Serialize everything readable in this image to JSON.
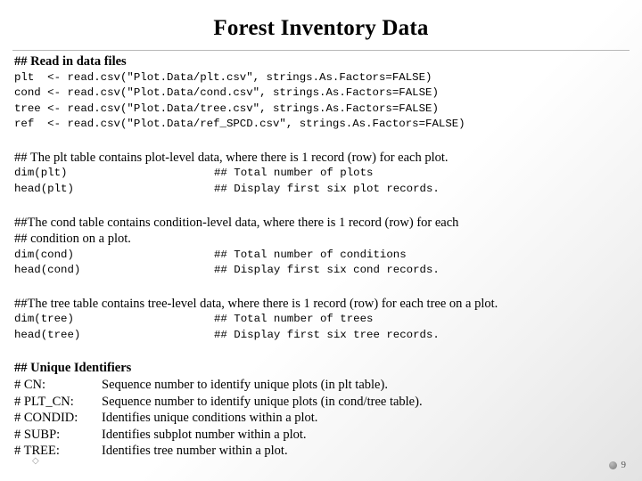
{
  "slide": {
    "title": "Forest Inventory Data",
    "page_number": "9",
    "sections": [
      {
        "heading": "## Read in data files",
        "code": [
          "plt  <- read.csv(\"Plot.Data/plt.csv\", strings.As.Factors=FALSE)",
          "cond <- read.csv(\"Plot.Data/cond.csv\", strings.As.Factors=FALSE)",
          "tree <- read.csv(\"Plot.Data/tree.csv\", strings.As.Factors=FALSE)",
          "ref  <- read.csv(\"Plot.Data/ref_SPCD.csv\", strings.As.Factors=FALSE)"
        ]
      },
      {
        "heading": "## The plt table contains plot-level data, where there is 1 record (row) for each plot.",
        "rows": [
          {
            "cmd": "dim(plt)",
            "comment": "## Total number of plots"
          },
          {
            "cmd": "head(plt)",
            "comment": "## Display first six plot records."
          }
        ]
      },
      {
        "heading": "##The cond table contains condition-level data, where there is 1 record (row) for each",
        "heading2": "## condition on a plot.",
        "rows": [
          {
            "cmd": "dim(cond)",
            "comment": "## Total number of conditions"
          },
          {
            "cmd": "head(cond)",
            "comment": "## Display first six cond records."
          }
        ]
      },
      {
        "heading": "##The tree table contains tree-level data, where there is 1 record (row) for each tree on a plot.",
        "rows": [
          {
            "cmd": "dim(tree)",
            "comment": "## Total number of trees"
          },
          {
            "cmd": "head(tree)",
            "comment": "## Display first six tree records."
          }
        ]
      }
    ],
    "identifiers": {
      "heading": "## Unique Identifiers",
      "items": [
        {
          "name": "# CN:",
          "desc": "Sequence number to identify unique plots (in plt table)."
        },
        {
          "name": "# PLT_CN:",
          "desc": "Sequence number to identify unique plots (in cond/tree table)."
        },
        {
          "name": "# CONDID:",
          "desc": "Identifies unique conditions within a plot."
        },
        {
          "name": "# SUBP:",
          "desc": "Identifies subplot number within a plot."
        },
        {
          "name": "# TREE:",
          "desc": "Identifies tree number within a plot."
        }
      ]
    }
  }
}
